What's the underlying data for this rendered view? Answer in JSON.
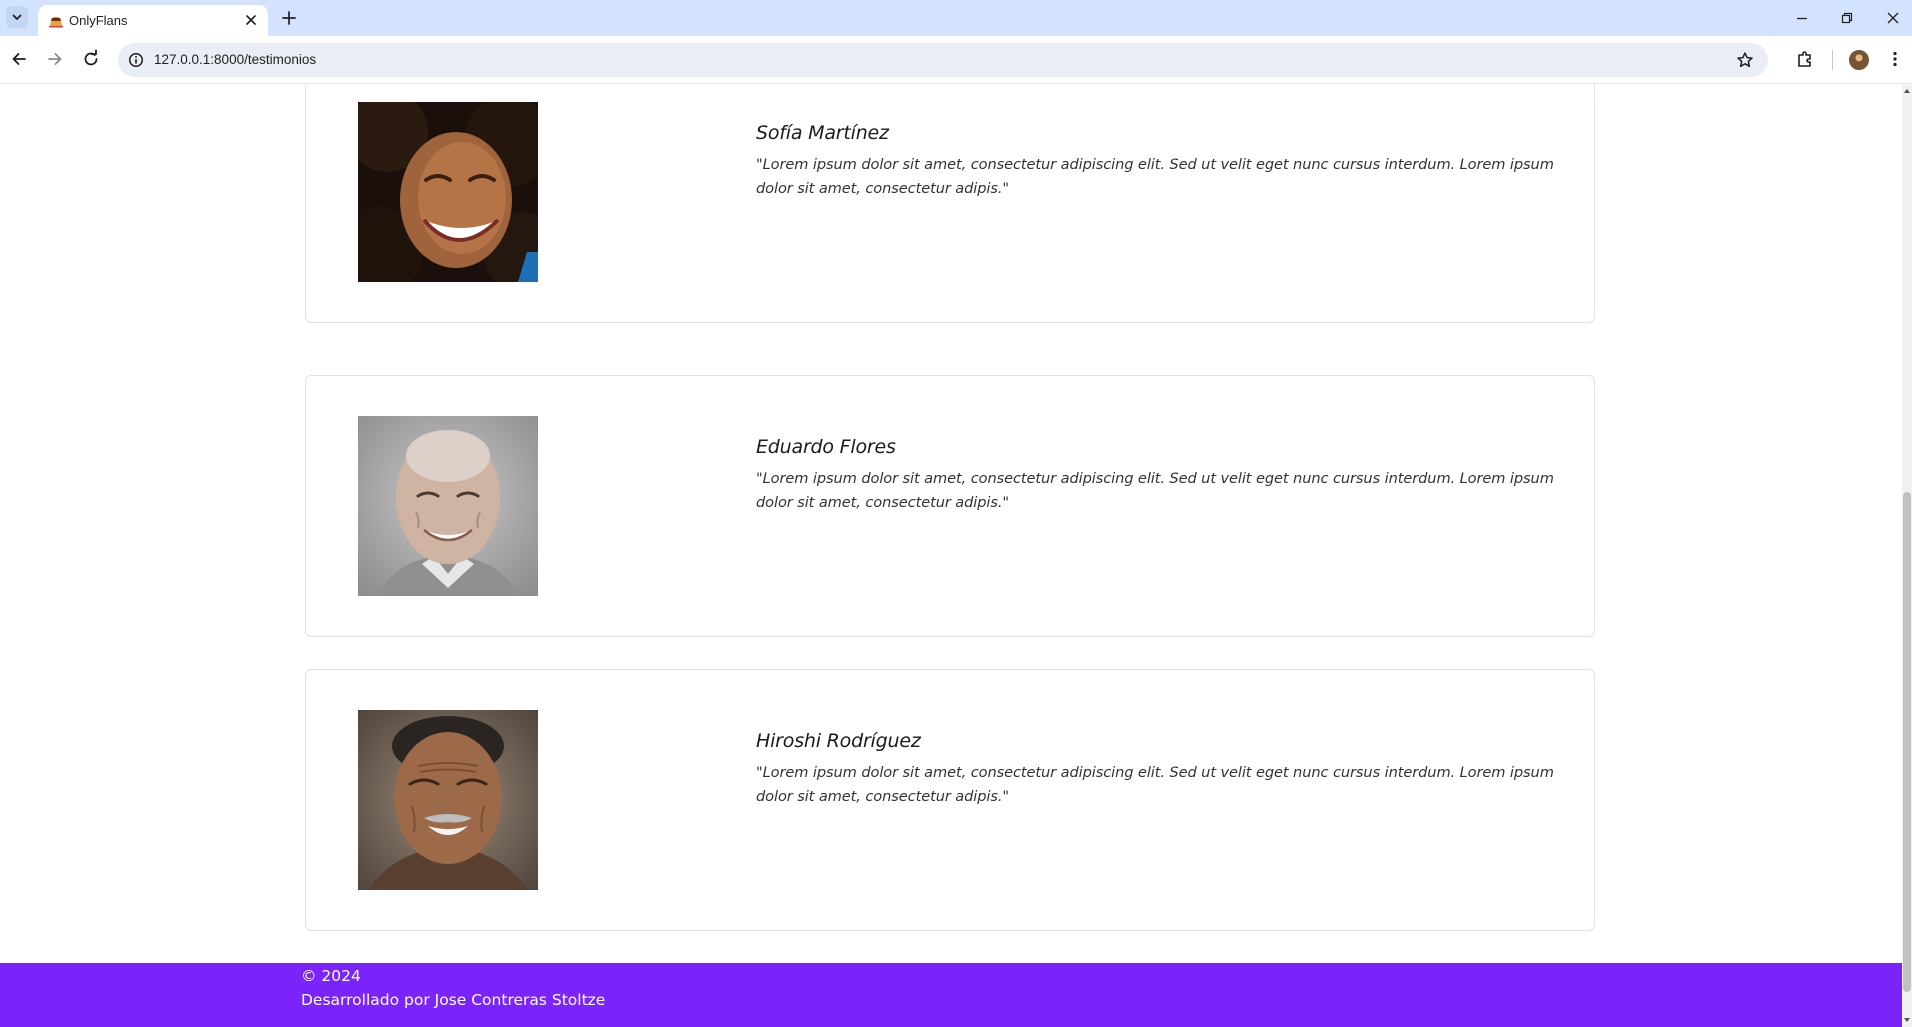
{
  "browser": {
    "tab_title": "OnlyFlans",
    "url": "127.0.0.1:8000/testimonios"
  },
  "testimonials": [
    {
      "name": "Sofía Martínez",
      "quote": "\"Lorem ipsum dolor sit amet, consectetur adipiscing elit. Sed ut velit eget nunc cursus interdum. Lorem ipsum dolor sit amet, consectetur adipis.\""
    },
    {
      "name": "Eduardo Flores",
      "quote": "\"Lorem ipsum dolor sit amet, consectetur adipiscing elit. Sed ut velit eget nunc cursus interdum. Lorem ipsum dolor sit amet, consectetur adipis.\""
    },
    {
      "name": "Hiroshi Rodríguez",
      "quote": "\"Lorem ipsum dolor sit amet, consectetur adipiscing elit. Sed ut velit eget nunc cursus interdum. Lorem ipsum dolor sit amet, consectetur adipis.\""
    }
  ],
  "footer": {
    "copyright": "© 2024",
    "credit": "Desarrollado por Jose Contreras Stoltze"
  },
  "colors": {
    "footer_bg": "#7b24fa",
    "tabstrip_bg": "#d3e3fd"
  }
}
